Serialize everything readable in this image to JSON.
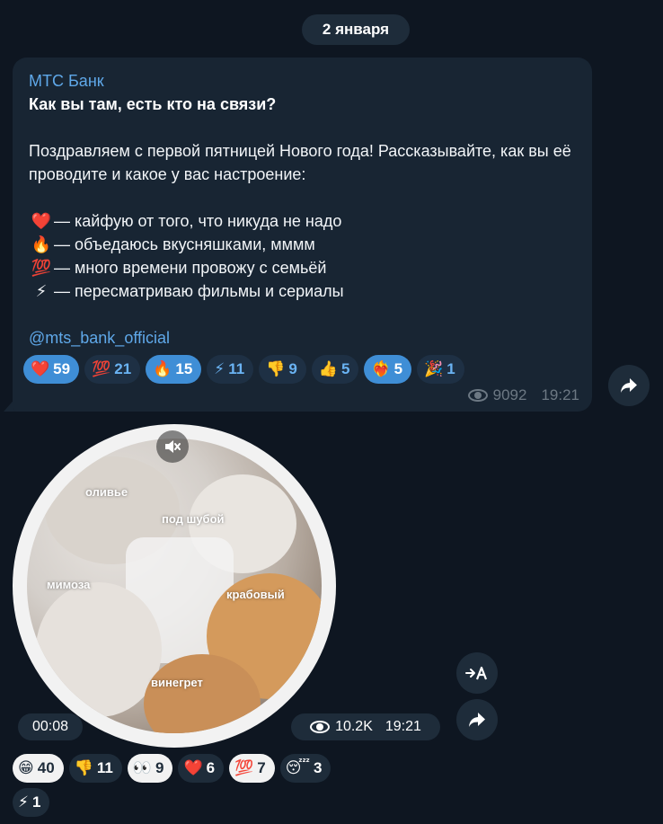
{
  "date_separator": "2 января",
  "post": {
    "sender": "МТС Банк",
    "title": "Как вы там, есть кто на связи?",
    "intro": "Поздравляем с первой пятницей Нового года! Рассказывайте, как вы её проводите и какое у вас настроение:",
    "options": [
      {
        "icon": "❤️",
        "text": "— кайфую от того, что никуда не надо"
      },
      {
        "icon": "🔥",
        "text": "— объедаюсь вкусняшками, мммм"
      },
      {
        "icon": "💯",
        "text": "— много времени провожу с семьёй"
      },
      {
        "icon": "⚡",
        "text": "— пересматриваю фильмы и сериалы"
      }
    ],
    "mention": "@mts_bank_official",
    "reactions": [
      {
        "icon": "❤️",
        "count": "59",
        "active": true
      },
      {
        "icon": "💯",
        "count": "21",
        "active": false
      },
      {
        "icon": "🔥",
        "count": "15",
        "active": true
      },
      {
        "icon": "⚡",
        "count": "11",
        "active": false
      },
      {
        "icon": "👎",
        "count": "9",
        "active": false
      },
      {
        "icon": "👍",
        "count": "5",
        "active": false
      },
      {
        "icon": "❤️‍🔥",
        "count": "5",
        "active": true
      },
      {
        "icon": "🎉",
        "count": "1",
        "active": false
      }
    ],
    "views": "9092",
    "time": "19:21"
  },
  "video": {
    "labels": {
      "olivie": "оливье",
      "shuba": "под шубой",
      "mimoza": "мимоза",
      "krab": "крабовый",
      "vinegret": "винегрет"
    },
    "duration": "00:08",
    "views": "10.2K",
    "time": "19:21",
    "reactions": [
      {
        "icon": "😁",
        "count": "40",
        "style": "light"
      },
      {
        "icon": "👎",
        "count": "11",
        "style": "dark"
      },
      {
        "icon": "👀",
        "count": "9",
        "style": "light"
      },
      {
        "icon": "❤️",
        "count": "6",
        "style": "dark"
      },
      {
        "icon": "💯",
        "count": "7",
        "style": "light"
      },
      {
        "icon": "😴",
        "count": "3",
        "style": "dark"
      },
      {
        "icon": "⚡",
        "count": "1",
        "style": "dark"
      }
    ]
  },
  "icons": {
    "share": "share-icon",
    "translate": "translate-icon",
    "mute": "mute-icon",
    "eye": "eye-icon"
  },
  "colors": {
    "background": "#0e1621",
    "bubble": "#182533",
    "accent": "#5fa8e9",
    "reaction_active": "#3f8ed6"
  }
}
